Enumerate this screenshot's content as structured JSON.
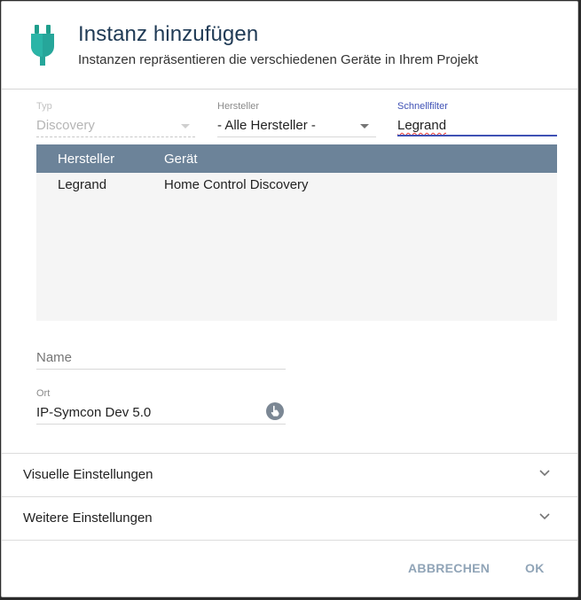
{
  "header": {
    "title": "Instanz hinzufügen",
    "subtitle": "Instanzen repräsentieren die verschiedenen Geräte in Ihrem Projekt",
    "icon": "plug-icon"
  },
  "filters": {
    "typ": {
      "label": "Typ",
      "value": "Discovery",
      "disabled": true
    },
    "hersteller": {
      "label": "Hersteller",
      "value": "- Alle Hersteller -"
    },
    "schnellfilter": {
      "label": "Schnellfilter",
      "value": "Legrand"
    }
  },
  "table": {
    "columns": [
      "Hersteller",
      "Gerät"
    ],
    "rows": [
      {
        "hersteller": "Legrand",
        "geraet": "Home Control Discovery"
      }
    ]
  },
  "form": {
    "name": {
      "placeholder": "Name",
      "value": ""
    },
    "ort": {
      "label": "Ort",
      "value": "IP-Symcon Dev 5.0",
      "icon": "locate-icon"
    }
  },
  "sections": [
    {
      "label": "Visuelle Einstellungen"
    },
    {
      "label": "Weitere Einstellungen"
    }
  ],
  "buttons": {
    "cancel": "ABBRECHEN",
    "ok": "OK"
  },
  "colors": {
    "accent": "#3f51b5",
    "table_header": "#6c8399",
    "title": "#1f3a55",
    "icon": "#26a69a",
    "button": "#90a4b7"
  }
}
